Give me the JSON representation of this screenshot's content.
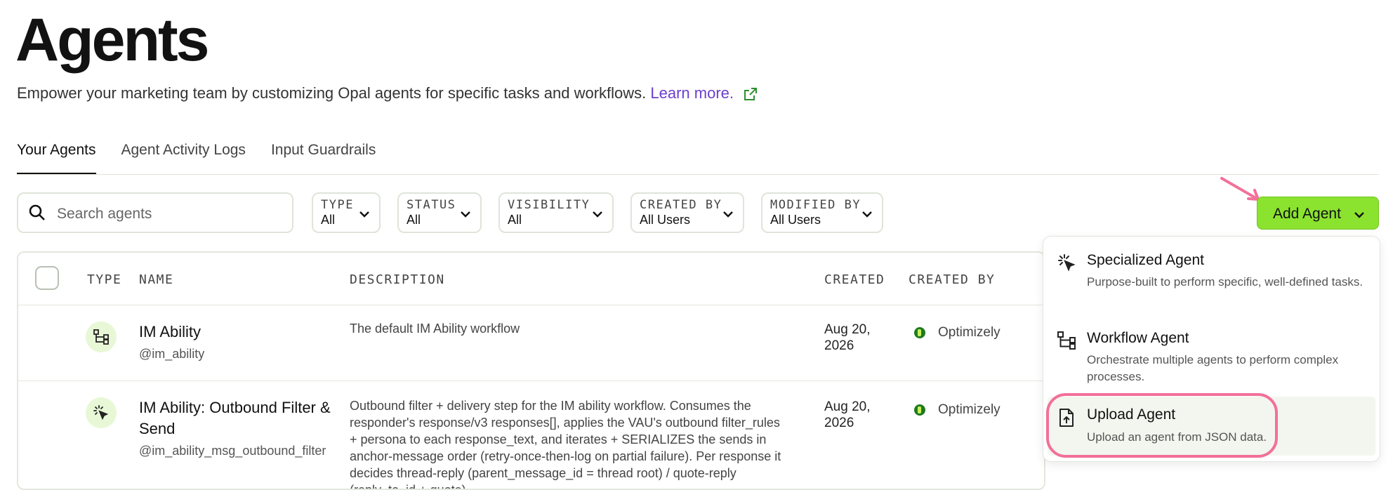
{
  "page": {
    "title": "Agents",
    "subtitle": "Empower your marketing team by customizing Opal agents for specific tasks and workflows.",
    "learn_more": "Learn more."
  },
  "tabs": [
    "Your Agents",
    "Agent Activity Logs",
    "Input Guardrails"
  ],
  "active_tab": "Your Agents",
  "search": {
    "placeholder": "Search agents"
  },
  "filters": [
    {
      "label": "TYPE",
      "value": "All"
    },
    {
      "label": "STATUS",
      "value": "All"
    },
    {
      "label": "VISIBILITY",
      "value": "All"
    },
    {
      "label": "CREATED BY",
      "value": "All Users"
    },
    {
      "label": "MODIFIED BY",
      "value": "All Users"
    }
  ],
  "add_agent": {
    "label": "Add Agent"
  },
  "table": {
    "headers": {
      "type": "TYPE",
      "name": "NAME",
      "description": "DESCRIPTION",
      "created": "CREATED",
      "created_by": "CREATED BY"
    },
    "rows": [
      {
        "type_icon": "workflow-icon",
        "name": "IM Ability",
        "handle": "@im_ability",
        "description": "The default IM Ability workflow",
        "created": "Aug 20, 2026",
        "created_by": "Optimizely"
      },
      {
        "type_icon": "specialized-icon",
        "name": "IM Ability: Outbound Filter & Send",
        "handle": "@im_ability_msg_outbound_filter",
        "description": "Outbound filter + delivery step for the IM ability workflow. Consumes the responder's response/v3 responses[], applies the VAU's outbound filter_rules + persona to each response_text, and iterates + SERIALIZES the sends in anchor-message order (retry-once-then-log on partial failure). Per response it decides thread-reply (parent_message_id = thread root) / quote-reply (reply_to_id + quote)",
        "created": "Aug 20, 2026",
        "created_by": "Optimizely"
      }
    ]
  },
  "dropdown": {
    "items": [
      {
        "icon": "cursor-click-icon",
        "title": "Specialized Agent",
        "description": "Purpose-built to perform specific, well-defined tasks."
      },
      {
        "icon": "workflow-icon",
        "title": "Workflow Agent",
        "description": "Orchestrate multiple agents to perform complex processes."
      },
      {
        "icon": "file-upload-icon",
        "title": "Upload Agent",
        "description": "Upload an agent from JSON data."
      }
    ]
  },
  "colors": {
    "accent_green": "#8be32f",
    "link_purple": "#6b3fcf",
    "highlight_pink": "#f2709a"
  }
}
